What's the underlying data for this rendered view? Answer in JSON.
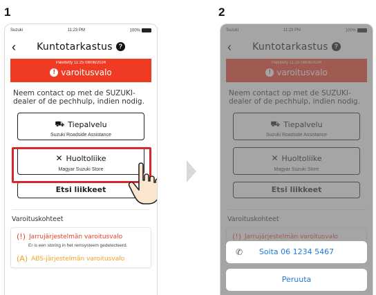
{
  "steps": {
    "first": "1",
    "second": "2"
  },
  "status_bar": {
    "carrier": "Suzuki",
    "time": "11:23 PM",
    "battery": "100%"
  },
  "header": {
    "title": "Kuntotarkastus",
    "back_icon": "chevron-left-icon",
    "help_icon": "question-circle-icon",
    "help_glyph": "?"
  },
  "alert": {
    "updated": "Päivitetty 11:25 08/08/2024",
    "label": "varoitusvalo",
    "glyph": "!",
    "color": "#ef3b24"
  },
  "info_text": "Neem contact op met de SUZUKI-dealer of de pechhulp, indien nodig.",
  "buttons": {
    "roadside": {
      "label": "Tiepalvelu",
      "sub": "Suzuki Roadside Assistance",
      "icon": "tow-truck-icon"
    },
    "service": {
      "label": "Huoltoliike",
      "sub": "Magyar Suzuki Store",
      "icon": "wrench-screwdriver-icon"
    },
    "find": {
      "label": "Etsi liikkeet"
    }
  },
  "section_label": "Varoituskohteet",
  "warnings": [
    {
      "label": "Jarrujärjestelmän varoitusvalo",
      "desc": "Er is een storing in het remsysteem gedetecteerd.",
      "color": "#ef3b24",
      "icon": "brake-warning-icon",
      "glyph": "(!)"
    },
    {
      "label": "ABS-järjestelmän varoitusvalo",
      "color": "#f0a41e",
      "icon": "abs-warning-icon",
      "glyph": "(A)"
    }
  ],
  "action_sheet": {
    "call_label": "Soita 06 1234 5467",
    "cancel_label": "Peruuta",
    "call_icon": "phone-icon"
  },
  "accent_colors": {
    "highlight": "#d9262b",
    "link": "#1e7ad6"
  }
}
